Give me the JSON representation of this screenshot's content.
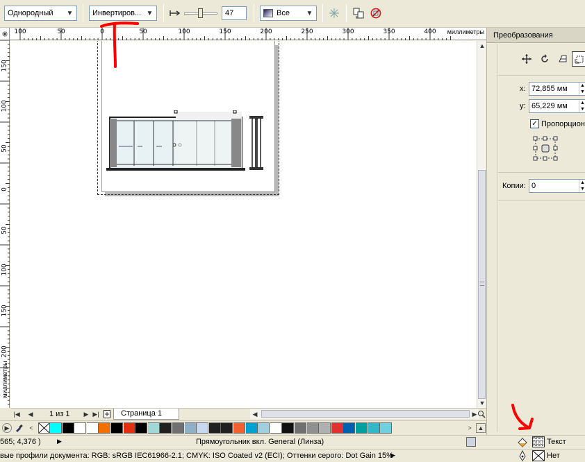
{
  "propbar": {
    "fill_type": "Однородный",
    "transparency_op": "Инвертиров...",
    "transparency_value": "47",
    "apply_to": "Все"
  },
  "rulers": {
    "h_labels": [
      "100",
      "50",
      "0",
      "50",
      "100",
      "150",
      "200",
      "250",
      "300",
      "350",
      "400"
    ],
    "h_unit": "миллиметры",
    "v_labels": [
      "150",
      "100",
      "50",
      "0",
      "50",
      "100",
      "150",
      "200"
    ],
    "v_unit": "миллиметры"
  },
  "page_nav": {
    "counter": "1 из 1",
    "tab": "Страница 1"
  },
  "palette": {
    "colors": [
      "#00ffff",
      "#000000",
      "#ffffff",
      "#ffffff",
      "#f07000",
      "#000000",
      "#e03010",
      "#000000",
      "#a0d8d8",
      "#202020",
      "#707070",
      "#90b0c8",
      "#c8d8f0",
      "#202020",
      "#202020",
      "#f06030",
      "#00a0d0",
      "#a0d0e0",
      "#ffffff",
      "#101010",
      "#707070",
      "#909090",
      "#b0b0b0",
      "#e03030",
      "#0060b0",
      "#00a0a0",
      "#30b8c8",
      "#70d0e0"
    ]
  },
  "status": {
    "coords": "565; 4,376 )",
    "object_info": "Прямоугольник вкл. General  (Линза)",
    "fill_label": "Текст",
    "outline_label": "Нет",
    "profiles": "вые профили документа: RGB: sRGB IEC61966-2.1; CMYK: ISO Coated v2 (ECI); Оттенки серого: Dot Gain 15%"
  },
  "docker": {
    "title": "Преобразования",
    "x_label": "x:",
    "x_value": "72,855 мм",
    "y_label": "y:",
    "y_value": "65,229 мм",
    "proportional_label": "Пропорциона",
    "copies_label": "Копии:",
    "copies_value": "0"
  }
}
